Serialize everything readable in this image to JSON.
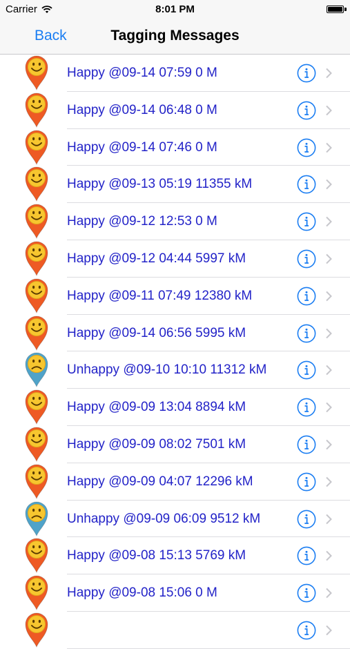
{
  "status_bar": {
    "carrier": "Carrier",
    "time": "8:01 PM"
  },
  "nav": {
    "back_label": "Back",
    "title": "Tagging Messages"
  },
  "colors": {
    "happy_pin": "#ee5a24",
    "unhappy_pin": "#4fa3c9",
    "link_text": "#2323c8",
    "accent": "#1a7df2"
  },
  "messages": [
    {
      "label": "Happy @09-14 07:59 0 M",
      "mood": "happy"
    },
    {
      "label": "Happy @09-14 06:48 0 M",
      "mood": "happy"
    },
    {
      "label": "Happy @09-14 07:46 0 M",
      "mood": "happy"
    },
    {
      "label": "Happy @09-13 05:19 11355 kM",
      "mood": "happy"
    },
    {
      "label": "Happy @09-12 12:53 0 M",
      "mood": "happy"
    },
    {
      "label": "Happy @09-12 04:44 5997 kM",
      "mood": "happy"
    },
    {
      "label": "Happy @09-11 07:49 12380 kM",
      "mood": "happy"
    },
    {
      "label": "Happy @09-14 06:56 5995 kM",
      "mood": "happy"
    },
    {
      "label": "Unhappy @09-10 10:10 11312 kM",
      "mood": "unhappy"
    },
    {
      "label": "Happy @09-09 13:04 8894 kM",
      "mood": "happy"
    },
    {
      "label": "Happy @09-09 08:02 7501 kM",
      "mood": "happy"
    },
    {
      "label": "Happy @09-09 04:07 12296 kM",
      "mood": "happy"
    },
    {
      "label": "Unhappy @09-09 06:09 9512 kM",
      "mood": "unhappy"
    },
    {
      "label": "Happy @09-08 15:13 5769 kM",
      "mood": "happy"
    },
    {
      "label": "Happy @09-08 15:06 0 M",
      "mood": "happy"
    },
    {
      "label": "",
      "mood": "happy"
    }
  ]
}
